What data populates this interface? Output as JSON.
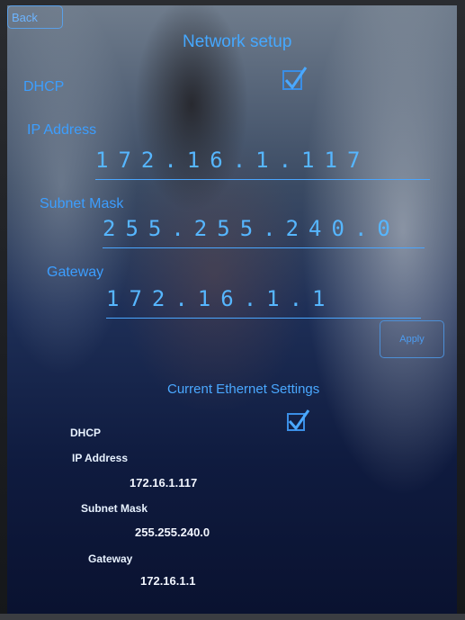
{
  "header": {
    "back_label": "Back",
    "title": "Network setup"
  },
  "form": {
    "dhcp_label": "DHCP",
    "dhcp_checked": true,
    "ip_label": "IP Address",
    "ip_value": "172.16.1.117",
    "subnet_label": "Subnet Mask",
    "subnet_value": "255.255.240.0",
    "gateway_label": "Gateway",
    "gateway_value": "172.16.1.1",
    "apply_label": "Apply"
  },
  "current": {
    "title": "Current Ethernet Settings",
    "dhcp_label": "DHCP",
    "dhcp_checked": true,
    "ip_label": "IP Address",
    "ip_value": "172.16.1.117",
    "subnet_label": "Subnet Mask",
    "subnet_value": "255.255.240.0",
    "gateway_label": "Gateway",
    "gateway_value": "172.16.1.1"
  },
  "colors": {
    "accent": "#3aa0ff",
    "text_white": "#f2f6ff"
  }
}
